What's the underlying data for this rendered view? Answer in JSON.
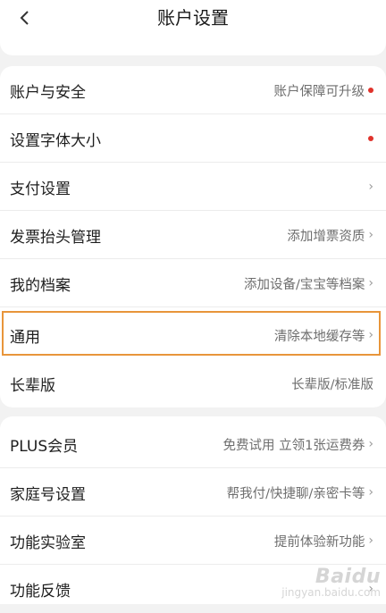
{
  "header": {
    "title": "账户设置",
    "back_icon": "chevron-left-icon"
  },
  "section1": {
    "items": [
      {
        "label": "账户与安全",
        "value": "账户保障可升级",
        "dot": true,
        "chevron": false
      },
      {
        "label": "设置字体大小",
        "value": "",
        "dot": true,
        "chevron": false
      },
      {
        "label": "支付设置",
        "value": "",
        "dot": false,
        "chevron": true
      },
      {
        "label": "发票抬头管理",
        "value": "添加增票资质",
        "dot": false,
        "chevron": true
      },
      {
        "label": "我的档案",
        "value": "添加设备/宝宝等档案",
        "dot": false,
        "chevron": true
      },
      {
        "label": "通用",
        "value": "清除本地缓存等",
        "dot": false,
        "chevron": true,
        "highlighted": true
      },
      {
        "label": "长辈版",
        "value": "长辈版/标准版",
        "dot": false,
        "chevron": false
      }
    ]
  },
  "section2": {
    "items": [
      {
        "label": "PLUS会员",
        "value": "免费试用 立领1张运费券",
        "chevron": true
      },
      {
        "label": "家庭号设置",
        "value": "帮我付/快捷聊/亲密卡等",
        "chevron": true
      },
      {
        "label": "功能实验室",
        "value": "提前体验新功能",
        "chevron": true
      },
      {
        "label": "功能反馈",
        "value": "",
        "chevron": true
      }
    ]
  },
  "watermark": {
    "logo": "Baidu",
    "sub": "jingyan.baidu.com"
  },
  "colors": {
    "highlight": "#e8953a",
    "dot": "#e0322b"
  }
}
